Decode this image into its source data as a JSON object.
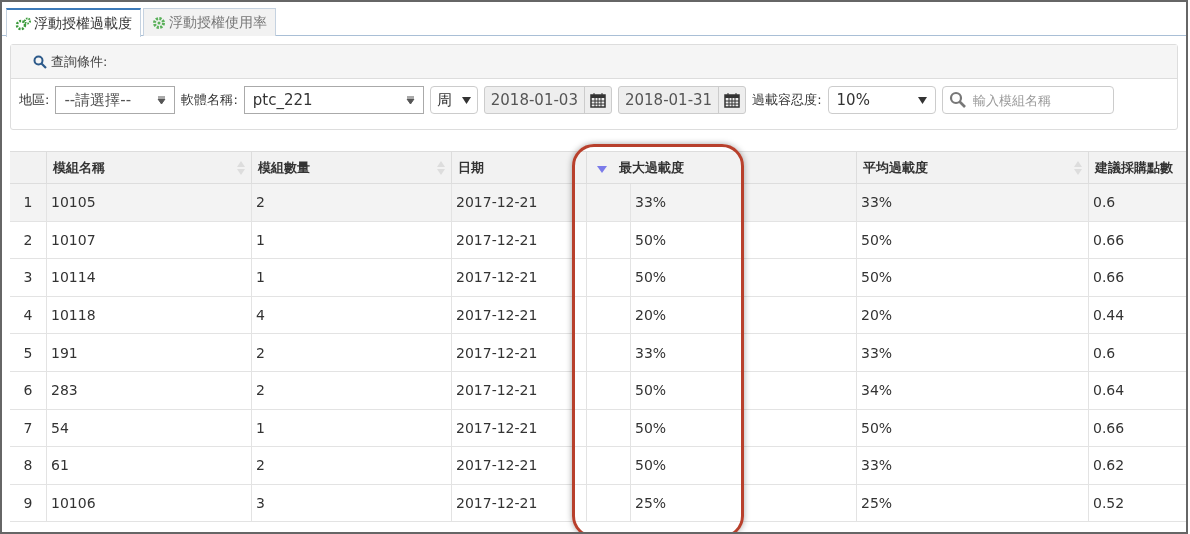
{
  "tabs": [
    {
      "label": "浮動授權過載度",
      "selected": true
    },
    {
      "label": "浮動授權使用率",
      "selected": false
    }
  ],
  "query": {
    "title": "查詢條件:",
    "region_label": "地區:",
    "region_value": "--請選擇--",
    "software_label": "軟體名稱:",
    "software_value": "ptc_221",
    "period_value": "周",
    "date_from": "2018-01-03",
    "date_to": "2018-01-31",
    "tolerance_label": "過載容忍度:",
    "tolerance_value": "10%",
    "search": {
      "placeholder": "輸入模組名稱"
    }
  },
  "table": {
    "columns": [
      {
        "label": "模組名稱",
        "sortable": true,
        "sorted": false
      },
      {
        "label": "模組數量",
        "sortable": true,
        "sorted": false
      },
      {
        "label": "日期",
        "sortable": false,
        "sorted": false
      },
      {
        "label": "最大過載度",
        "sortable": false,
        "sorted": true
      },
      {
        "label": "平均過載度",
        "sortable": true,
        "sorted": false
      },
      {
        "label": "建議採購點數",
        "sortable": false,
        "sorted": false
      }
    ],
    "rows": [
      {
        "n": "1",
        "cells": [
          "10105",
          "2",
          "2017-12-21",
          "33%",
          "33%",
          "0.6"
        ],
        "selected": true
      },
      {
        "n": "2",
        "cells": [
          "10107",
          "1",
          "2017-12-21",
          "50%",
          "50%",
          "0.66"
        ],
        "selected": false
      },
      {
        "n": "3",
        "cells": [
          "10114",
          "1",
          "2017-12-21",
          "50%",
          "50%",
          "0.66"
        ],
        "selected": false
      },
      {
        "n": "4",
        "cells": [
          "10118",
          "4",
          "2017-12-21",
          "20%",
          "20%",
          "0.44"
        ],
        "selected": false
      },
      {
        "n": "5",
        "cells": [
          "191",
          "2",
          "2017-12-21",
          "33%",
          "33%",
          "0.6"
        ],
        "selected": false
      },
      {
        "n": "6",
        "cells": [
          "283",
          "2",
          "2017-12-21",
          "50%",
          "34%",
          "0.64"
        ],
        "selected": false
      },
      {
        "n": "7",
        "cells": [
          "54",
          "1",
          "2017-12-21",
          "50%",
          "50%",
          "0.66"
        ],
        "selected": false
      },
      {
        "n": "8",
        "cells": [
          "61",
          "2",
          "2017-12-21",
          "50%",
          "33%",
          "0.62"
        ],
        "selected": false
      },
      {
        "n": "9",
        "cells": [
          "10106",
          "3",
          "2017-12-21",
          "25%",
          "25%",
          "0.52"
        ],
        "selected": false
      }
    ]
  }
}
